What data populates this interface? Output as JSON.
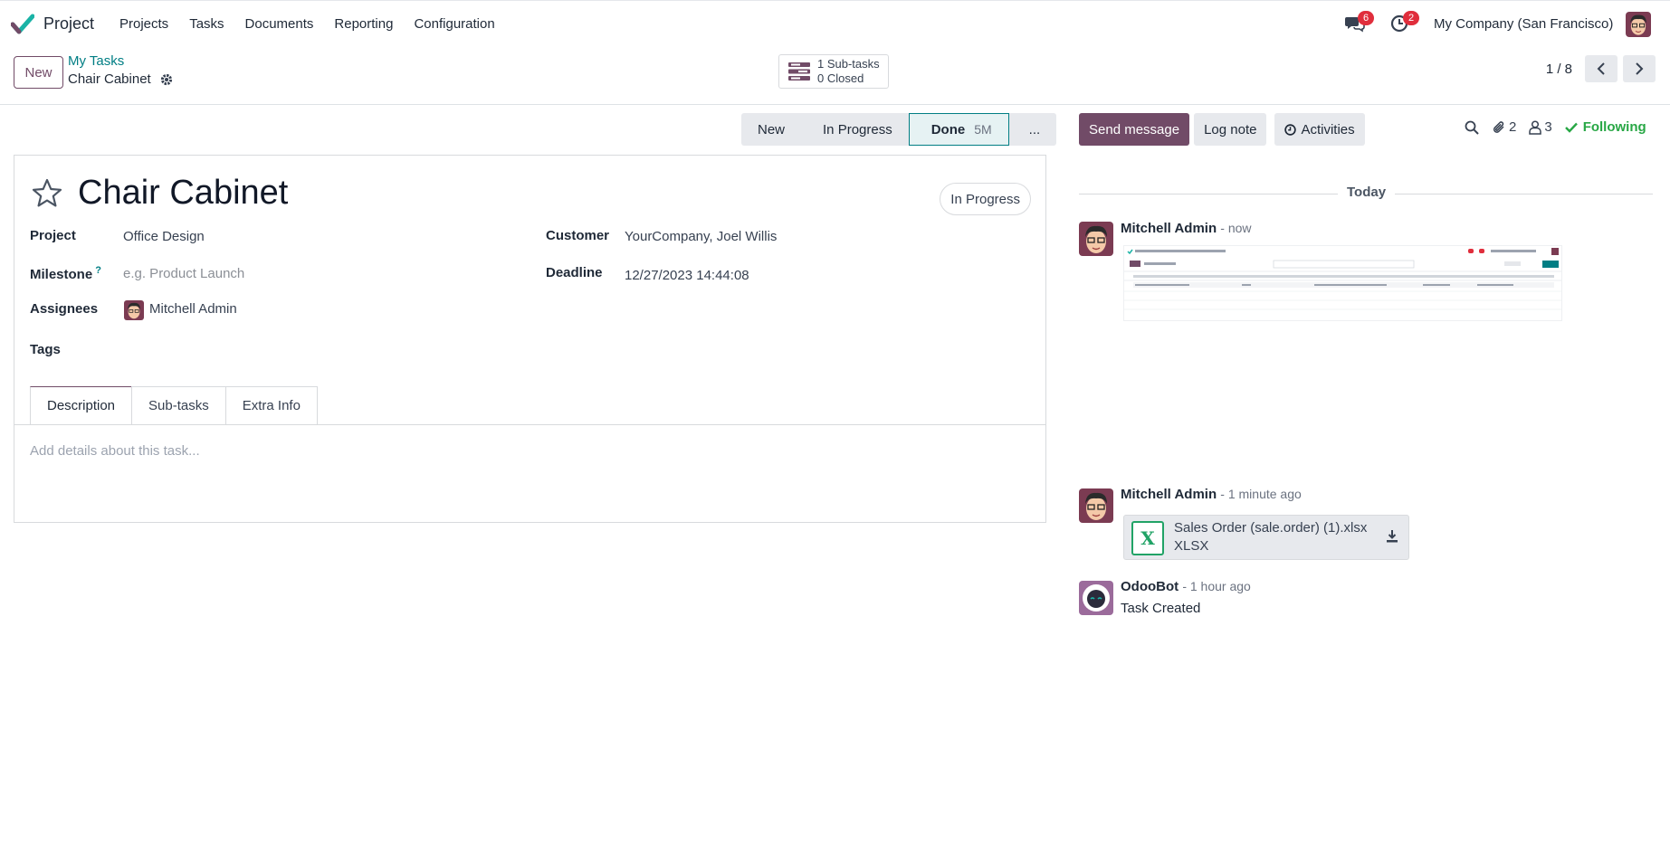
{
  "navbar": {
    "app_name": "Project",
    "menu": [
      "Projects",
      "Tasks",
      "Documents",
      "Reporting",
      "Configuration"
    ],
    "messages_badge": "6",
    "activities_badge": "2",
    "company": "My Company (San Francisco)"
  },
  "control": {
    "new_label": "New",
    "breadcrumb_parent": "My Tasks",
    "breadcrumb_current": "Chair Cabinet",
    "subtasks_count": "1 Sub-tasks",
    "subtasks_closed": "0 Closed",
    "pager": "1 / 8"
  },
  "statusbar": {
    "stages": [
      "New",
      "In Progress",
      "Done",
      "..."
    ],
    "active_stage": "Done",
    "active_count": "5M"
  },
  "form": {
    "title": "Chair Cabinet",
    "state": "In Progress",
    "project_label": "Project",
    "project_value": "Office Design",
    "milestone_label": "Milestone",
    "milestone_help": "?",
    "milestone_placeholder": "e.g. Product Launch",
    "assignees_label": "Assignees",
    "assignee": "Mitchell Admin",
    "tags_label": "Tags",
    "customer_label": "Customer",
    "customer_value": "YourCompany, Joel Willis",
    "deadline_label": "Deadline",
    "deadline_value": "12/27/2023 14:44:08",
    "tabs": [
      "Description",
      "Sub-tasks",
      "Extra Info"
    ],
    "description_placeholder": "Add details about this task..."
  },
  "chatter": {
    "send_message": "Send message",
    "log_note": "Log note",
    "activities": "Activities",
    "attachments_count": "2",
    "followers_count": "3",
    "following": "Following",
    "date_separator": "Today",
    "messages": [
      {
        "author": "Mitchell Admin",
        "time": "- now"
      },
      {
        "author": "Mitchell Admin",
        "time": "- 1 minute ago",
        "attachment_name": "Sales Order (sale.order) (1).xlsx",
        "attachment_type": "XLSX"
      },
      {
        "author": "OdooBot",
        "time": "- 1 hour ago",
        "body": "Task Created"
      }
    ]
  },
  "colors": {
    "brand": "#714b67",
    "teal": "#017e84",
    "following": "#28a745",
    "badge": "#e02e3c"
  }
}
